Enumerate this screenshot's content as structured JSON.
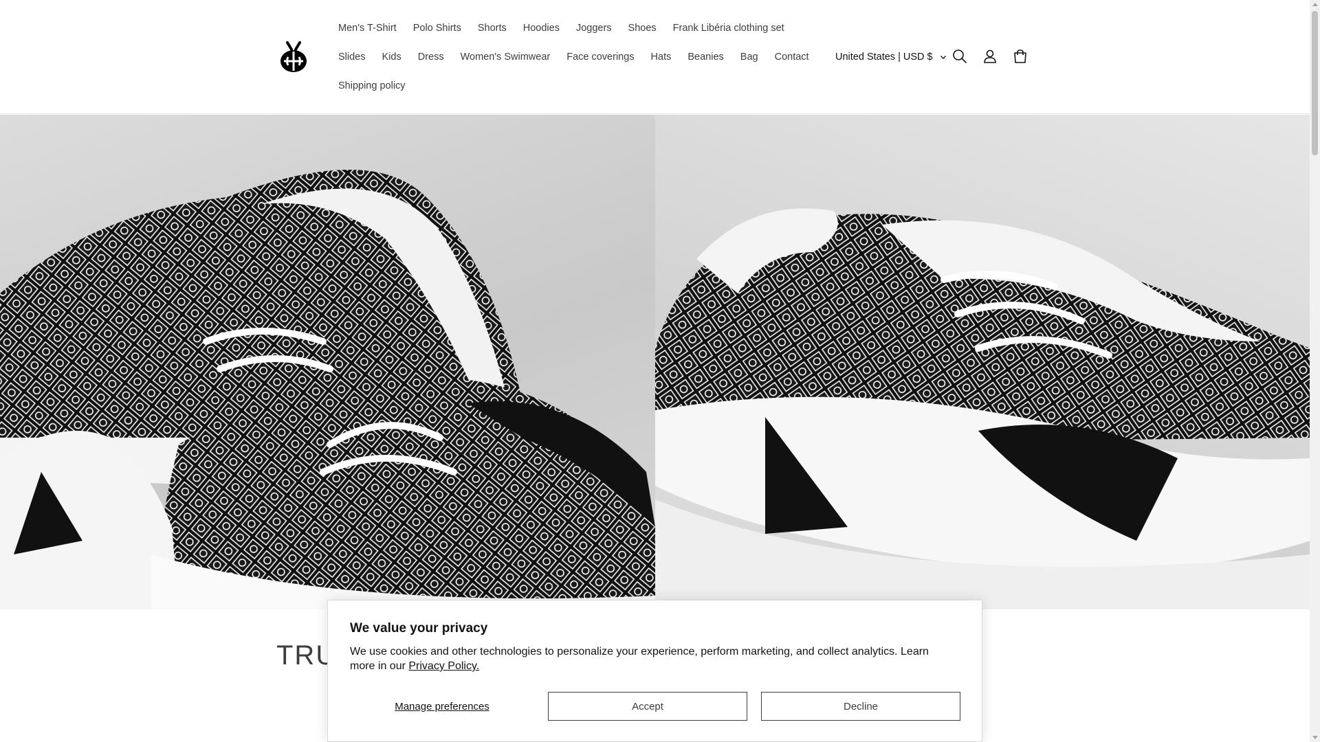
{
  "header": {
    "nav_row_1": [
      "Men's T-Shirt",
      "Polo Shirts",
      "Shorts",
      "Hoodies",
      "Joggers",
      "Shoes",
      "Frank Libéria clothing set"
    ],
    "nav_row_2": [
      "Slides",
      "Kids",
      "Dress",
      "Women's Swimwear",
      "Face coverings",
      "Hats",
      "Beanies",
      "Bag",
      "Contact"
    ],
    "nav_row_3": [
      "Shipping policy"
    ],
    "locale": "United States | USD $",
    "icons": [
      "search-icon",
      "account-icon",
      "cart-icon"
    ]
  },
  "hero": {
    "images": [
      "patterned-sneaker-left",
      "patterned-sneaker-right"
    ]
  },
  "section": {
    "heading": "TRU"
  },
  "cookie_banner": {
    "title": "We value your privacy",
    "text": "We use cookies and other technologies to personalize your experience, perform marketing, and collect analytics. Learn more in our ",
    "link": "Privacy Policy.",
    "manage": "Manage preferences",
    "accept": "Accept",
    "decline": "Decline"
  },
  "colors": {
    "text": "#121212",
    "nav_text": "#3d3d3d",
    "border": "#3d3d3d"
  }
}
